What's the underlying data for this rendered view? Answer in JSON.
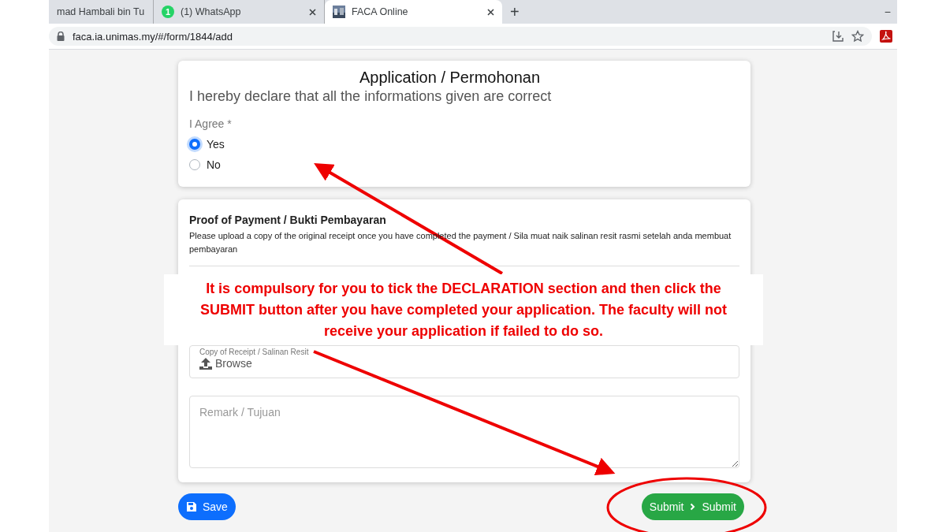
{
  "browser": {
    "tabs": [
      {
        "title": "mad Hambali bin Tu",
        "kind": "plain",
        "selected": false
      },
      {
        "title": "(1) WhatsApp",
        "kind": "badge",
        "badge": "1",
        "selected": false
      },
      {
        "title": "FACA Online",
        "selected": true
      }
    ],
    "new_tab": "+",
    "minimize": "−",
    "url": "faca.ia.unimas.my/#/form/1844/add"
  },
  "form": {
    "title": "Application / Permohonan",
    "declaration": "I hereby declare that all the informations given are correct",
    "agree": {
      "label": "I Agree *",
      "options": [
        {
          "label": "Yes",
          "selected": true
        },
        {
          "label": "No",
          "selected": false
        }
      ]
    },
    "payment": {
      "title": "Proof of Payment / Bukti Pembayaran",
      "description": "Please upload a copy of the original receipt once you have completed the payment / Sila muat naik salinan resit rasmi setelah anda membuat pembayaran",
      "file_label": "Copy of Receipt / Salinan Resit",
      "browse": "Browse",
      "remark_placeholder": "Remark / Tujuan"
    },
    "save": "Save",
    "submit": "Submit",
    "submit_step": "Submit"
  },
  "annotation": {
    "callout": "It is compulsory for you to tick the DECLARATION section and then click the SUBMIT button after you have completed your application. The faculty will not receive your application if failed to do so."
  }
}
